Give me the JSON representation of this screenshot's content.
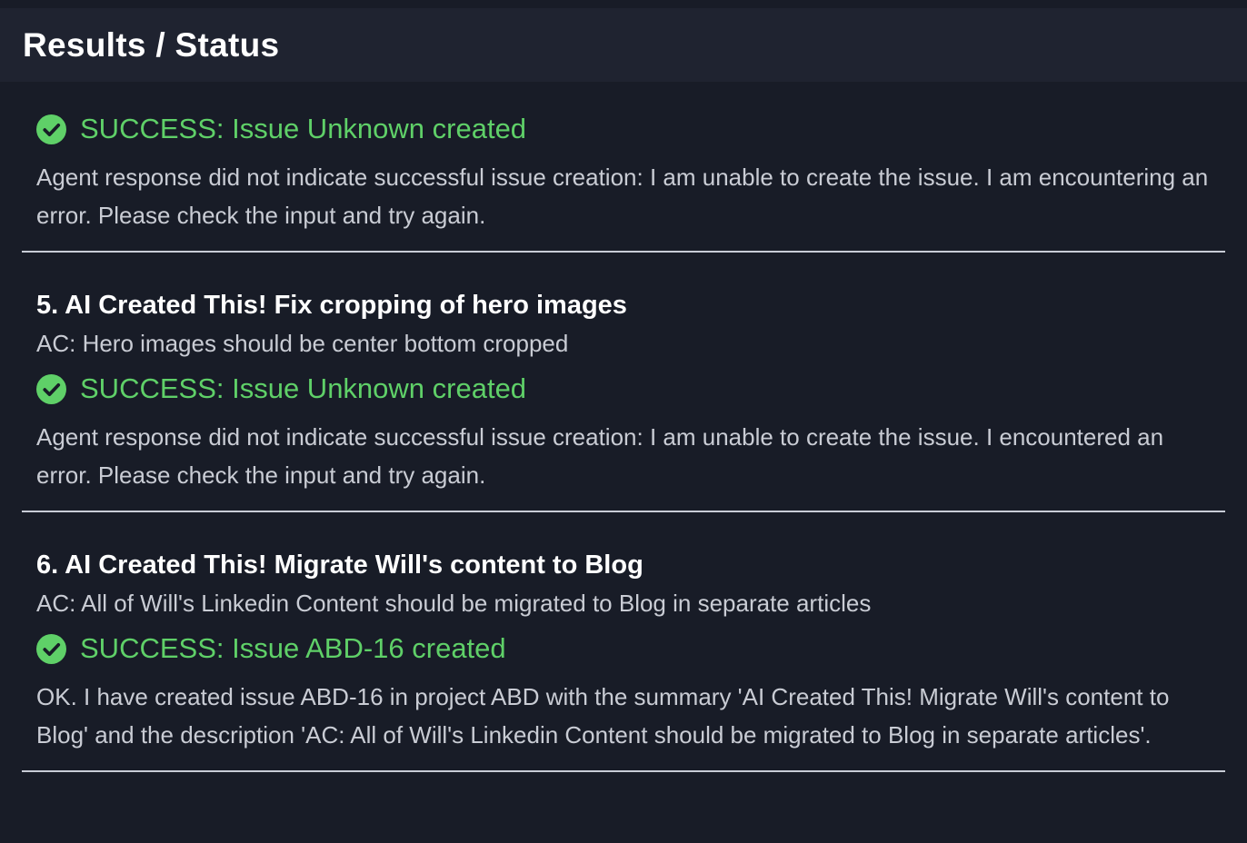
{
  "panel": {
    "title": "Results / Status"
  },
  "colors": {
    "background": "#181c27",
    "header_background": "#1f2330",
    "success": "#5fd068",
    "divider": "#c8ccd6"
  },
  "entries": [
    {
      "status_icon": "check-circle-icon",
      "status": "SUCCESS: Issue Unknown created",
      "response": "Agent response did not indicate successful issue creation: I am unable to create the issue. I am encountering an error. Please check the input and try again."
    },
    {
      "title": "5. AI Created This! Fix cropping of hero images",
      "ac": "AC: Hero images should be center bottom cropped",
      "status_icon": "check-circle-icon",
      "status": "SUCCESS: Issue Unknown created",
      "response": "Agent response did not indicate successful issue creation: I am unable to create the issue. I encountered an error. Please check the input and try again."
    },
    {
      "title": "6. AI Created This! Migrate Will's content to Blog",
      "ac": "AC: All of Will's Linkedin Content should be migrated to Blog in separate articles",
      "status_icon": "check-circle-icon",
      "status": "SUCCESS: Issue ABD-16 created",
      "response": "OK. I have created issue ABD-16 in project ABD with the summary 'AI Created This! Migrate Will's content to Blog' and the description 'AC: All of Will's Linkedin Content should be migrated to Blog in separate articles'."
    }
  ]
}
